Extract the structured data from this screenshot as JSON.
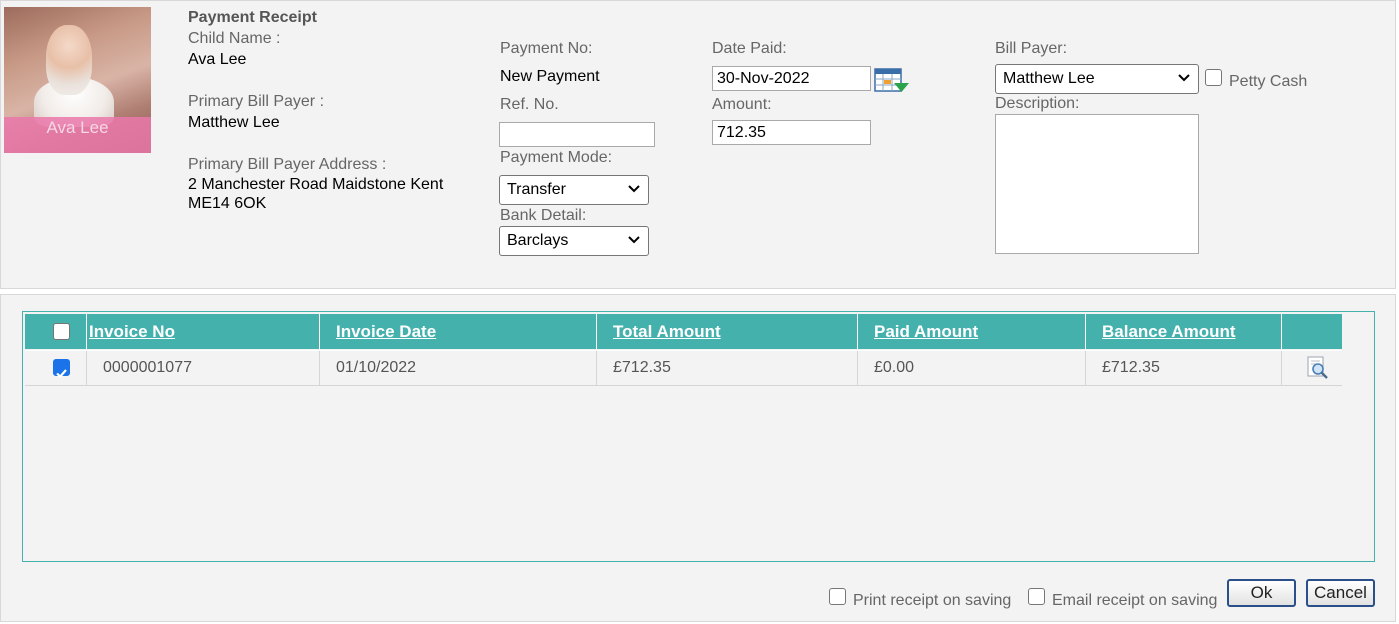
{
  "receipt": {
    "title": "Payment Receipt",
    "child_name_label": "Child Name :",
    "child_name": "Ava Lee",
    "photo_caption": "Ava Lee",
    "primary_bill_payer_label": "Primary Bill Payer :",
    "primary_bill_payer": "Matthew Lee",
    "address_label": "Primary Bill Payer Address :",
    "address_line1": "2 Manchester Road Maidstone Kent",
    "address_line2": "ME14 6OK"
  },
  "form": {
    "payment_no_label": "Payment No:",
    "payment_no_value": "New Payment",
    "ref_no_label": "Ref. No.",
    "ref_no_value": "",
    "payment_mode_label": "Payment Mode:",
    "payment_mode_value": "Transfer",
    "bank_detail_label": "Bank Detail:",
    "bank_detail_value": "Barclays",
    "date_paid_label": "Date Paid:",
    "date_paid_value": "30-Nov-2022",
    "amount_label": "Amount:",
    "amount_value": "712.35",
    "bill_payer_label": "Bill Payer:",
    "bill_payer_value": "Matthew Lee",
    "petty_cash_label": "Petty Cash",
    "petty_cash_checked": false,
    "description_label": "Description:",
    "description_value": ""
  },
  "table": {
    "columns": [
      "Invoice No",
      "Invoice Date",
      "Total Amount",
      "Paid Amount",
      "Balance Amount"
    ],
    "rows": [
      {
        "selected": true,
        "invoice_no": "0000001077",
        "invoice_date": "01/10/2022",
        "total_amount": "£712.35",
        "paid_amount": "£0.00",
        "balance_amount": "£712.35",
        "action_icon": "view-invoice-icon"
      }
    ]
  },
  "footer": {
    "print_receipt_label": "Print receipt on saving",
    "email_receipt_label": "Email receipt on saving",
    "ok_label": "Ok",
    "cancel_label": "Cancel"
  },
  "colors": {
    "header_teal": "#45b1ad",
    "panel_bg": "#f3f3f3",
    "checkbox_blue": "#1a73e8",
    "photo_band_pink": "#ea78aa"
  }
}
